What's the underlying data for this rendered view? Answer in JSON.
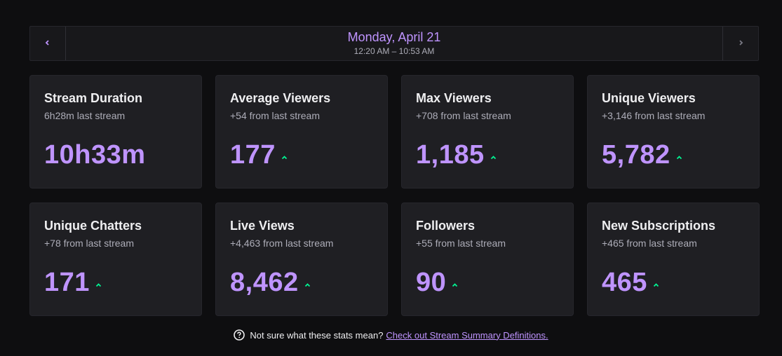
{
  "header": {
    "date": "Monday, April 21",
    "time_range": "12:20 AM – 10:53 AM",
    "prev_icon": "chevron-left-icon",
    "next_icon": "chevron-right-icon"
  },
  "stats": [
    {
      "title": "Stream Duration",
      "subtitle": "6h28m last stream",
      "value": "10h33m",
      "trend": "none"
    },
    {
      "title": "Average Viewers",
      "subtitle": "+54 from last stream",
      "value": "177",
      "trend": "up"
    },
    {
      "title": "Max Viewers",
      "subtitle": "+708 from last stream",
      "value": "1,185",
      "trend": "up"
    },
    {
      "title": "Unique Viewers",
      "subtitle": "+3,146 from last stream",
      "value": "5,782",
      "trend": "up"
    },
    {
      "title": "Unique Chatters",
      "subtitle": "+78 from last stream",
      "value": "171",
      "trend": "up"
    },
    {
      "title": "Live Views",
      "subtitle": "+4,463 from last stream",
      "value": "8,462",
      "trend": "up"
    },
    {
      "title": "Followers",
      "subtitle": "+55 from last stream",
      "value": "90",
      "trend": "up"
    },
    {
      "title": "New Subscriptions",
      "subtitle": "+465 from last stream",
      "value": "465",
      "trend": "up"
    }
  ],
  "footer": {
    "question": "Not sure what these stats mean?",
    "link": "Check out Stream Summary Definitions.",
    "icon": "help-circle-icon"
  },
  "colors": {
    "accent": "#bf94ff",
    "trend_up": "#00f593",
    "card_bg": "#1f1f23",
    "page_bg": "#0e0e10"
  }
}
